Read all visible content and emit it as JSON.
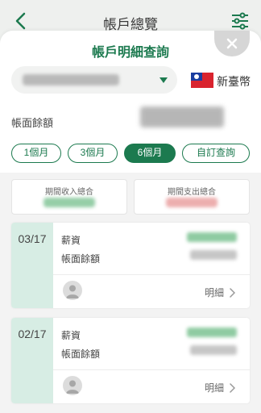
{
  "background": {
    "title": "帳戶總覽",
    "back_icon": "chevron-left-icon",
    "filter_icon": "sliders-icon"
  },
  "sheet": {
    "title": "帳戶明細查詢",
    "close_icon": "close-icon",
    "account_select": {
      "selected_value": ""
    },
    "currency": "新臺幣",
    "balance_label": "帳面餘額",
    "tabs": [
      {
        "label": "1個月",
        "active": false
      },
      {
        "label": "3個月",
        "active": false
      },
      {
        "label": "6個月",
        "active": true
      },
      {
        "label": "自訂查詢",
        "active": false
      }
    ],
    "summary": {
      "income_label": "期間收入總合",
      "expense_label": "期間支出總合"
    },
    "transactions": [
      {
        "date": "03/17",
        "type": "薪資",
        "balance_label": "帳面餘額",
        "detail_label": "明細"
      },
      {
        "date": "02/17",
        "type": "薪資",
        "balance_label": "帳面餘額",
        "detail_label": "明細"
      }
    ]
  },
  "colors": {
    "brand": "#1c7a4f",
    "date_column": "#d7ede4",
    "income": "#7cc292",
    "expense": "#e89a9a"
  }
}
